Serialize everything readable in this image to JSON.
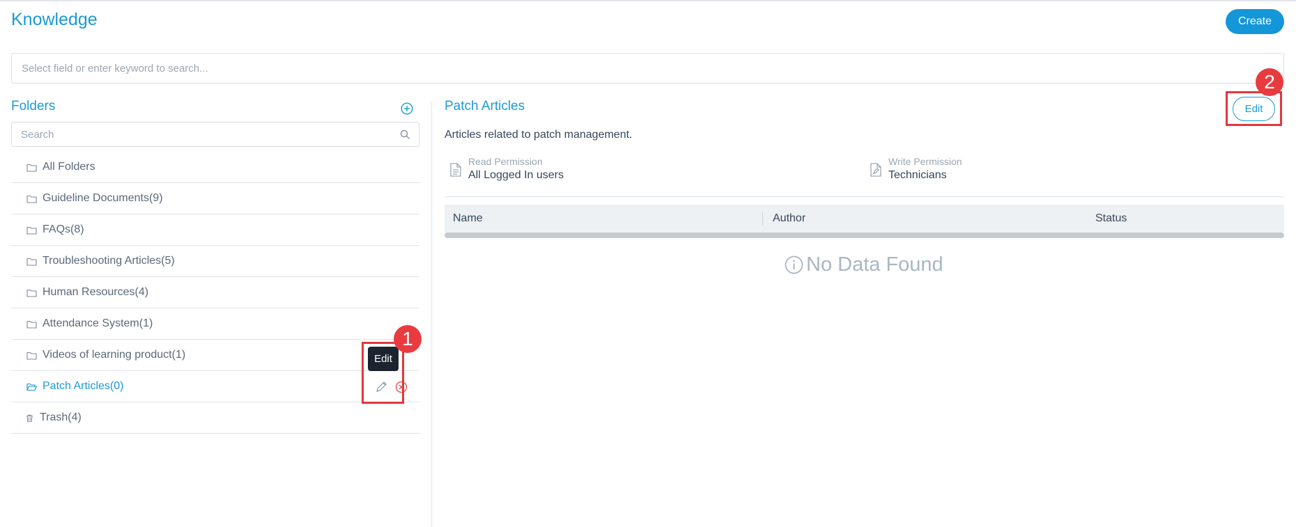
{
  "header": {
    "title": "Knowledge",
    "create_label": "Create"
  },
  "search": {
    "placeholder": "Select field or enter keyword to search..."
  },
  "folders": {
    "title": "Folders",
    "search_placeholder": "Search",
    "items": [
      {
        "label": "All Folders",
        "icon": "folder-icon"
      },
      {
        "label": "Guideline Documents(9)",
        "icon": "folder-icon"
      },
      {
        "label": "FAQs(8)",
        "icon": "folder-icon"
      },
      {
        "label": "Troubleshooting Articles(5)",
        "icon": "folder-icon"
      },
      {
        "label": "Human Resources(4)",
        "icon": "folder-icon"
      },
      {
        "label": "Attendance System(1)",
        "icon": "folder-icon"
      },
      {
        "label": "Videos of learning product(1)",
        "icon": "folder-icon"
      },
      {
        "label": "Patch Articles(0)",
        "icon": "folder-open-icon",
        "active": true
      },
      {
        "label": "Trash(4)",
        "icon": "trash-icon"
      }
    ],
    "tooltip": "Edit"
  },
  "detail": {
    "title": "Patch Articles",
    "edit_label": "Edit",
    "description": "Articles related to patch management.",
    "read_permission": {
      "label": "Read Permission",
      "value": "All Logged In users"
    },
    "write_permission": {
      "label": "Write Permission",
      "value": "Technicians"
    },
    "columns": [
      "Name",
      "Author",
      "Status"
    ],
    "empty_text": "No Data Found"
  },
  "annotations": {
    "badge_1": "1",
    "badge_2": "2"
  },
  "colors": {
    "accent": "#1b9ad6",
    "annotation": "#e1373d",
    "delete": "#e8453c"
  }
}
